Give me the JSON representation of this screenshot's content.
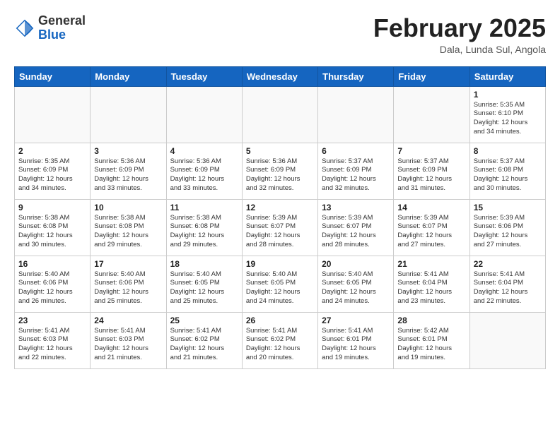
{
  "header": {
    "logo_general": "General",
    "logo_blue": "Blue",
    "title": "February 2025",
    "location": "Dala, Lunda Sul, Angola"
  },
  "weekdays": [
    "Sunday",
    "Monday",
    "Tuesday",
    "Wednesday",
    "Thursday",
    "Friday",
    "Saturday"
  ],
  "weeks": [
    [
      {
        "day": "",
        "info": ""
      },
      {
        "day": "",
        "info": ""
      },
      {
        "day": "",
        "info": ""
      },
      {
        "day": "",
        "info": ""
      },
      {
        "day": "",
        "info": ""
      },
      {
        "day": "",
        "info": ""
      },
      {
        "day": "1",
        "info": "Sunrise: 5:35 AM\nSunset: 6:10 PM\nDaylight: 12 hours\nand 34 minutes."
      }
    ],
    [
      {
        "day": "2",
        "info": "Sunrise: 5:35 AM\nSunset: 6:09 PM\nDaylight: 12 hours\nand 34 minutes."
      },
      {
        "day": "3",
        "info": "Sunrise: 5:36 AM\nSunset: 6:09 PM\nDaylight: 12 hours\nand 33 minutes."
      },
      {
        "day": "4",
        "info": "Sunrise: 5:36 AM\nSunset: 6:09 PM\nDaylight: 12 hours\nand 33 minutes."
      },
      {
        "day": "5",
        "info": "Sunrise: 5:36 AM\nSunset: 6:09 PM\nDaylight: 12 hours\nand 32 minutes."
      },
      {
        "day": "6",
        "info": "Sunrise: 5:37 AM\nSunset: 6:09 PM\nDaylight: 12 hours\nand 32 minutes."
      },
      {
        "day": "7",
        "info": "Sunrise: 5:37 AM\nSunset: 6:09 PM\nDaylight: 12 hours\nand 31 minutes."
      },
      {
        "day": "8",
        "info": "Sunrise: 5:37 AM\nSunset: 6:08 PM\nDaylight: 12 hours\nand 30 minutes."
      }
    ],
    [
      {
        "day": "9",
        "info": "Sunrise: 5:38 AM\nSunset: 6:08 PM\nDaylight: 12 hours\nand 30 minutes."
      },
      {
        "day": "10",
        "info": "Sunrise: 5:38 AM\nSunset: 6:08 PM\nDaylight: 12 hours\nand 29 minutes."
      },
      {
        "day": "11",
        "info": "Sunrise: 5:38 AM\nSunset: 6:08 PM\nDaylight: 12 hours\nand 29 minutes."
      },
      {
        "day": "12",
        "info": "Sunrise: 5:39 AM\nSunset: 6:07 PM\nDaylight: 12 hours\nand 28 minutes."
      },
      {
        "day": "13",
        "info": "Sunrise: 5:39 AM\nSunset: 6:07 PM\nDaylight: 12 hours\nand 28 minutes."
      },
      {
        "day": "14",
        "info": "Sunrise: 5:39 AM\nSunset: 6:07 PM\nDaylight: 12 hours\nand 27 minutes."
      },
      {
        "day": "15",
        "info": "Sunrise: 5:39 AM\nSunset: 6:06 PM\nDaylight: 12 hours\nand 27 minutes."
      }
    ],
    [
      {
        "day": "16",
        "info": "Sunrise: 5:40 AM\nSunset: 6:06 PM\nDaylight: 12 hours\nand 26 minutes."
      },
      {
        "day": "17",
        "info": "Sunrise: 5:40 AM\nSunset: 6:06 PM\nDaylight: 12 hours\nand 25 minutes."
      },
      {
        "day": "18",
        "info": "Sunrise: 5:40 AM\nSunset: 6:05 PM\nDaylight: 12 hours\nand 25 minutes."
      },
      {
        "day": "19",
        "info": "Sunrise: 5:40 AM\nSunset: 6:05 PM\nDaylight: 12 hours\nand 24 minutes."
      },
      {
        "day": "20",
        "info": "Sunrise: 5:40 AM\nSunset: 6:05 PM\nDaylight: 12 hours\nand 24 minutes."
      },
      {
        "day": "21",
        "info": "Sunrise: 5:41 AM\nSunset: 6:04 PM\nDaylight: 12 hours\nand 23 minutes."
      },
      {
        "day": "22",
        "info": "Sunrise: 5:41 AM\nSunset: 6:04 PM\nDaylight: 12 hours\nand 22 minutes."
      }
    ],
    [
      {
        "day": "23",
        "info": "Sunrise: 5:41 AM\nSunset: 6:03 PM\nDaylight: 12 hours\nand 22 minutes."
      },
      {
        "day": "24",
        "info": "Sunrise: 5:41 AM\nSunset: 6:03 PM\nDaylight: 12 hours\nand 21 minutes."
      },
      {
        "day": "25",
        "info": "Sunrise: 5:41 AM\nSunset: 6:02 PM\nDaylight: 12 hours\nand 21 minutes."
      },
      {
        "day": "26",
        "info": "Sunrise: 5:41 AM\nSunset: 6:02 PM\nDaylight: 12 hours\nand 20 minutes."
      },
      {
        "day": "27",
        "info": "Sunrise: 5:41 AM\nSunset: 6:01 PM\nDaylight: 12 hours\nand 19 minutes."
      },
      {
        "day": "28",
        "info": "Sunrise: 5:42 AM\nSunset: 6:01 PM\nDaylight: 12 hours\nand 19 minutes."
      },
      {
        "day": "",
        "info": ""
      }
    ]
  ]
}
